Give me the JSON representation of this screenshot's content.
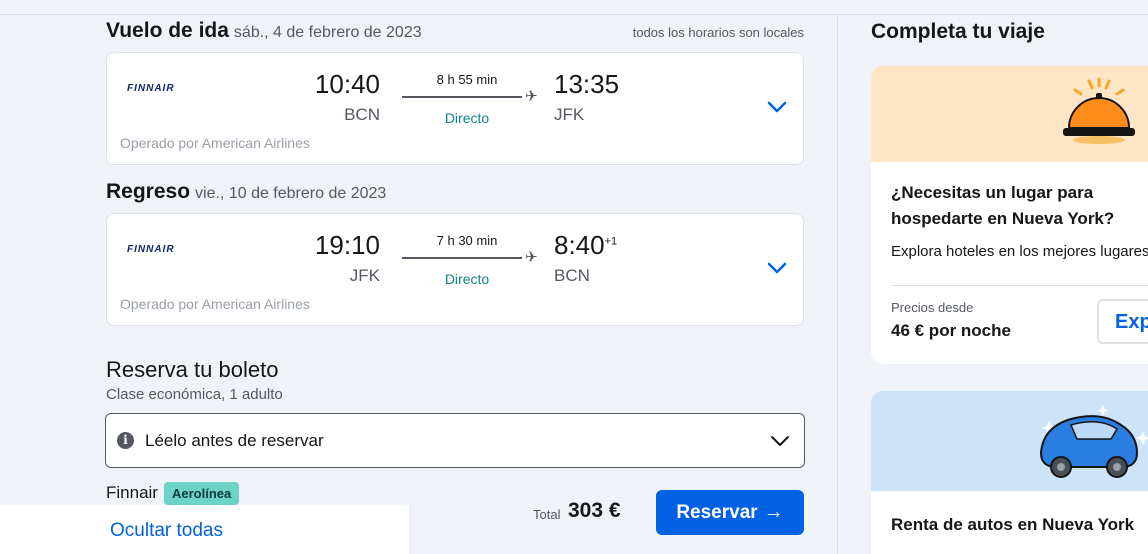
{
  "outbound": {
    "title": "Vuelo de ida",
    "date": "sáb., 4 de febrero de 2023",
    "note": "todos los horarios son locales",
    "airline": "FINNAIR",
    "depart_time": "10:40",
    "depart_code": "BCN",
    "arrive_time": "13:35",
    "arrive_code": "JFK",
    "duration": "8 h 55 min",
    "stops": "Directo",
    "operated_by": "Operado por American Airlines"
  },
  "return": {
    "title": "Regreso",
    "date": "vie., 10 de febrero de 2023",
    "airline": "FINNAIR",
    "depart_time": "19:10",
    "depart_code": "JFK",
    "arrive_time": "8:40",
    "arrive_day_offset": "+1",
    "arrive_code": "BCN",
    "duration": "7 h 30 min",
    "stops": "Directo",
    "operated_by": "Operado por American Airlines"
  },
  "booking": {
    "title": "Reserva tu boleto",
    "subtitle": "Clase económica, 1 adulto",
    "readme_label": "Léelo antes de reservar",
    "provider": "Finnair",
    "provider_badge": "Aerolínea",
    "total_label": "Total",
    "total_value": "303 €",
    "book_button": "Reservar"
  },
  "hide_all_link": "Ocultar todas",
  "sidebar": {
    "title": "Completa tu viaje",
    "hotel": {
      "heading": "¿Necesitas un lugar para hospedarte en Nueva York?",
      "description": "Explora hoteles en los mejores lugares",
      "price_label": "Precios desde",
      "price_value": "46 € por noche",
      "button": "Explorar"
    },
    "car": {
      "heading": "Renta de autos en Nueva York"
    }
  },
  "colors": {
    "accent": "#0062e3",
    "direct": "#0c838a",
    "badge": "#6dd3c6",
    "hotel_bg": "#fde5c6",
    "car_bg": "#cde3fa"
  }
}
